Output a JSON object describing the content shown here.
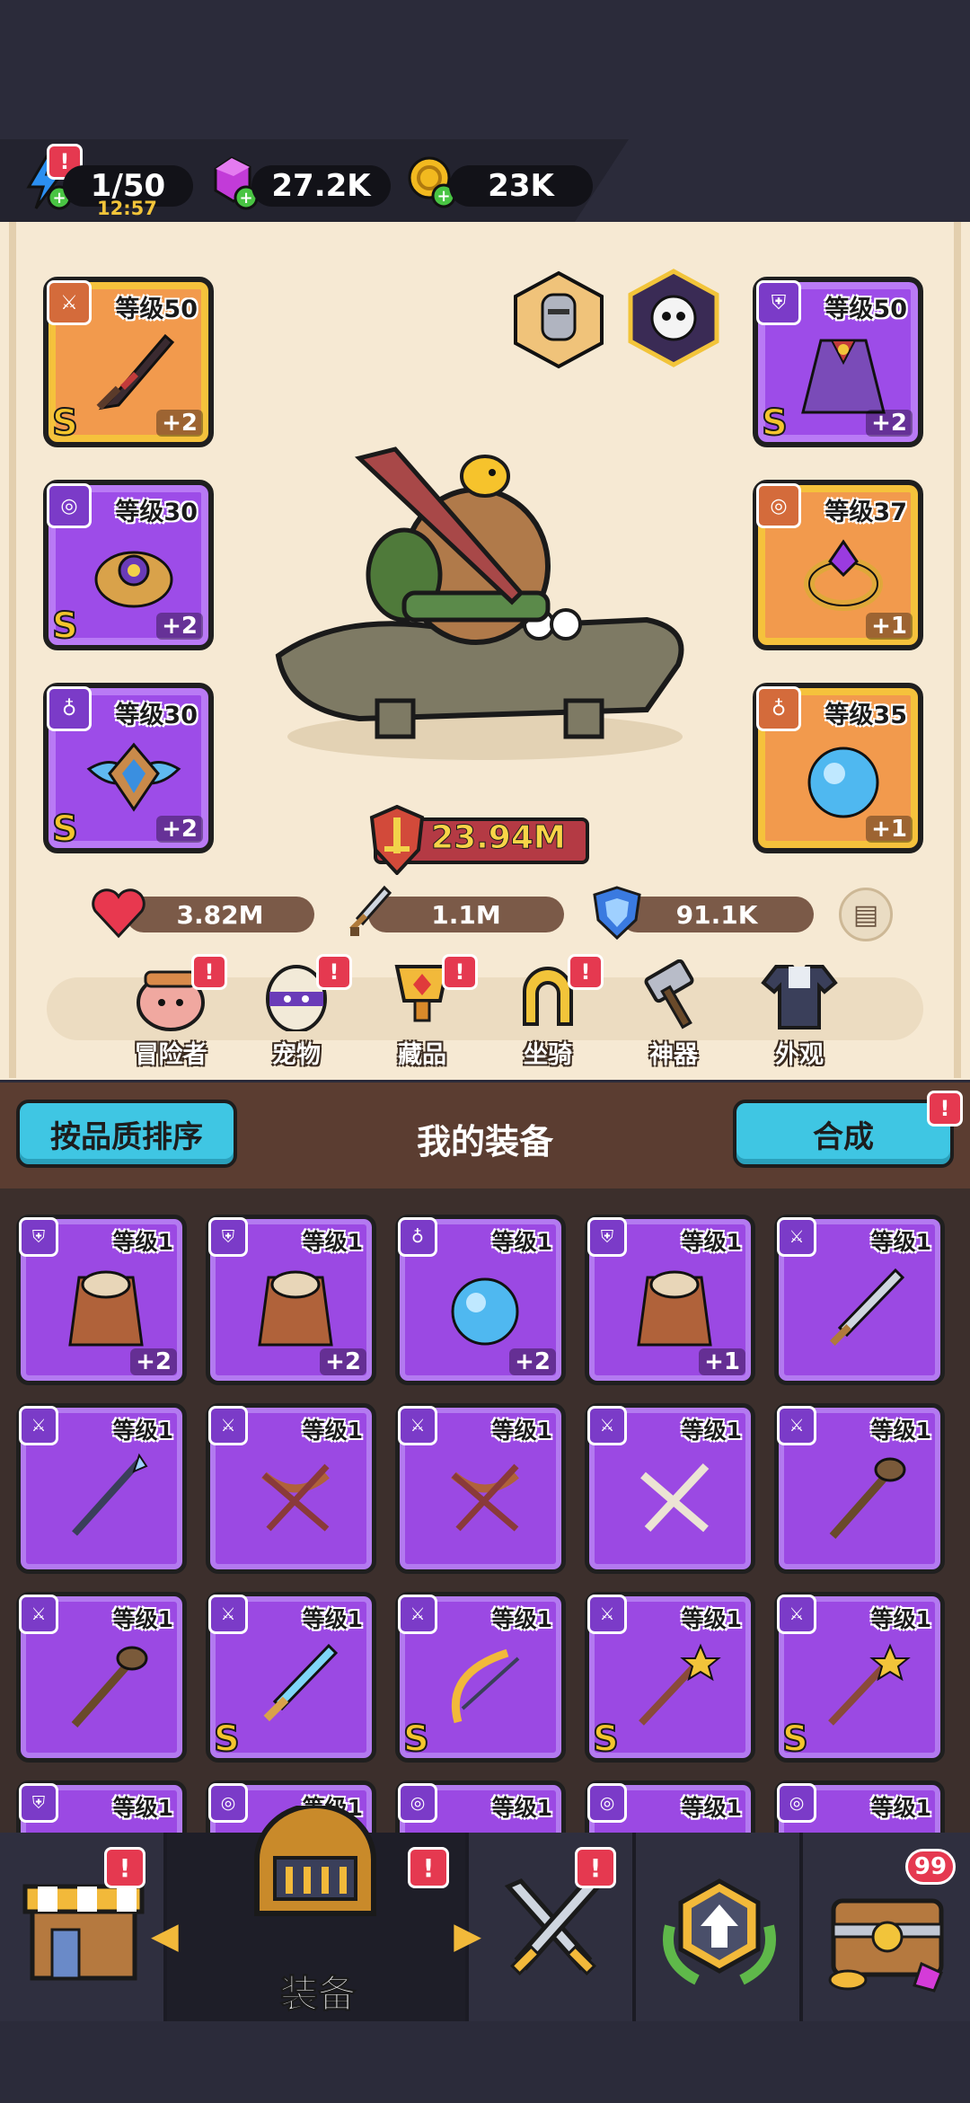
{
  "resources": {
    "energy": {
      "value": "1/50",
      "timer": "12:57",
      "icon": "lightning-icon"
    },
    "gems": {
      "value": "27.2K",
      "icon": "purple-gem-icon"
    },
    "coins": {
      "value": "23K",
      "icon": "gold-coin-icon"
    },
    "alert": "!"
  },
  "equipped": [
    {
      "slot": "weapon",
      "level": "等级50",
      "plus": "+2",
      "grade": "S",
      "rarity": "orange",
      "icon": "sword-icon"
    },
    {
      "slot": "armor",
      "level": "等级50",
      "plus": "+2",
      "grade": "S",
      "rarity": "purple",
      "icon": "armor-icon"
    },
    {
      "slot": "belt",
      "level": "等级30",
      "plus": "+2",
      "grade": "S",
      "rarity": "purple",
      "icon": "belt-icon"
    },
    {
      "slot": "ring",
      "level": "等级37",
      "plus": "+1",
      "grade": "",
      "rarity": "orange",
      "icon": "ring-icon"
    },
    {
      "slot": "necklace",
      "level": "等级30",
      "plus": "+2",
      "grade": "S",
      "rarity": "purple",
      "icon": "necklace-icon"
    },
    {
      "slot": "orb",
      "level": "等级35",
      "plus": "+1",
      "grade": "",
      "rarity": "orange",
      "icon": "necklace-icon"
    }
  ],
  "power": {
    "value": "23.94M",
    "icon": "power-sword-icon"
  },
  "stats": {
    "hp": {
      "value": "3.82M",
      "icon": "heart-icon"
    },
    "attack": {
      "value": "1.1M",
      "icon": "sword-icon"
    },
    "defense": {
      "value": "91.1K",
      "icon": "shield-icon"
    }
  },
  "menu": [
    {
      "label": "冒险者",
      "icon": "adventurer-icon",
      "badge": "!"
    },
    {
      "label": "宠物",
      "icon": "pet-egg-icon",
      "badge": "!"
    },
    {
      "label": "藏品",
      "icon": "collection-trophy-icon",
      "badge": "!"
    },
    {
      "label": "坐骑",
      "icon": "mount-horseshoe-icon",
      "badge": "!"
    },
    {
      "label": "神器",
      "icon": "artifact-hammer-icon",
      "badge": ""
    },
    {
      "label": "外观",
      "icon": "appearance-outfit-icon",
      "badge": ""
    }
  ],
  "inventory_header": {
    "sort_button": "按品质排序",
    "title": "我的装备",
    "merge_button": "合成",
    "merge_badge": "!"
  },
  "inventory": [
    {
      "level": "等级1",
      "plus": "+2",
      "grade": "",
      "icon": "leather-armor-icon"
    },
    {
      "level": "等级1",
      "plus": "+2",
      "grade": "",
      "icon": "leather-armor-icon"
    },
    {
      "level": "等级1",
      "plus": "+2",
      "grade": "",
      "icon": "blue-orb-icon"
    },
    {
      "level": "等级1",
      "plus": "+1",
      "grade": "",
      "icon": "leather-armor-icon"
    },
    {
      "level": "等级1",
      "plus": "",
      "grade": "",
      "icon": "sword-icon"
    },
    {
      "level": "等级1",
      "plus": "",
      "grade": "",
      "icon": "spear-icon"
    },
    {
      "level": "等级1",
      "plus": "",
      "grade": "",
      "icon": "crossbow-icon"
    },
    {
      "level": "等级1",
      "plus": "",
      "grade": "",
      "icon": "crossbow-icon"
    },
    {
      "level": "等级1",
      "plus": "",
      "grade": "",
      "icon": "bone-crossbow-icon"
    },
    {
      "level": "等级1",
      "plus": "",
      "grade": "",
      "icon": "staff-icon"
    },
    {
      "level": "等级1",
      "plus": "",
      "grade": "",
      "icon": "staff-icon"
    },
    {
      "level": "等级1",
      "plus": "",
      "grade": "S",
      "icon": "ice-sword-icon"
    },
    {
      "level": "等级1",
      "plus": "",
      "grade": "S",
      "icon": "golden-bow-icon"
    },
    {
      "level": "等级1",
      "plus": "",
      "grade": "S",
      "icon": "star-wand-icon"
    },
    {
      "level": "等级1",
      "plus": "",
      "grade": "S",
      "icon": "star-wand-icon"
    },
    {
      "level": "等级1",
      "plus": "",
      "grade": "",
      "icon": "armor-icon"
    },
    {
      "level": "等级1",
      "plus": "",
      "grade": "",
      "icon": "belt-icon"
    },
    {
      "level": "等级1",
      "plus": "",
      "grade": "",
      "icon": "belt-icon"
    },
    {
      "level": "等级1",
      "plus": "",
      "grade": "",
      "icon": "belt-icon"
    },
    {
      "level": "等级1",
      "plus": "",
      "grade": "",
      "icon": "belt-icon"
    }
  ],
  "bottom_nav": [
    {
      "label": "",
      "icon": "shop-icon",
      "badge": "!"
    },
    {
      "label": "装备",
      "icon": "helmet-icon",
      "badge": "!",
      "active": true
    },
    {
      "label": "",
      "icon": "crossed-swords-icon",
      "badge": "!"
    },
    {
      "label": "",
      "icon": "upgrade-arrow-icon",
      "badge": ""
    },
    {
      "label": "",
      "icon": "treasure-chest-icon",
      "badge": "99"
    }
  ],
  "colors": {
    "orange_card": "#f29a4d",
    "purple_card": "#9d4ce8",
    "accent_blue": "#3fc6e3",
    "alert_red": "#e53950"
  }
}
